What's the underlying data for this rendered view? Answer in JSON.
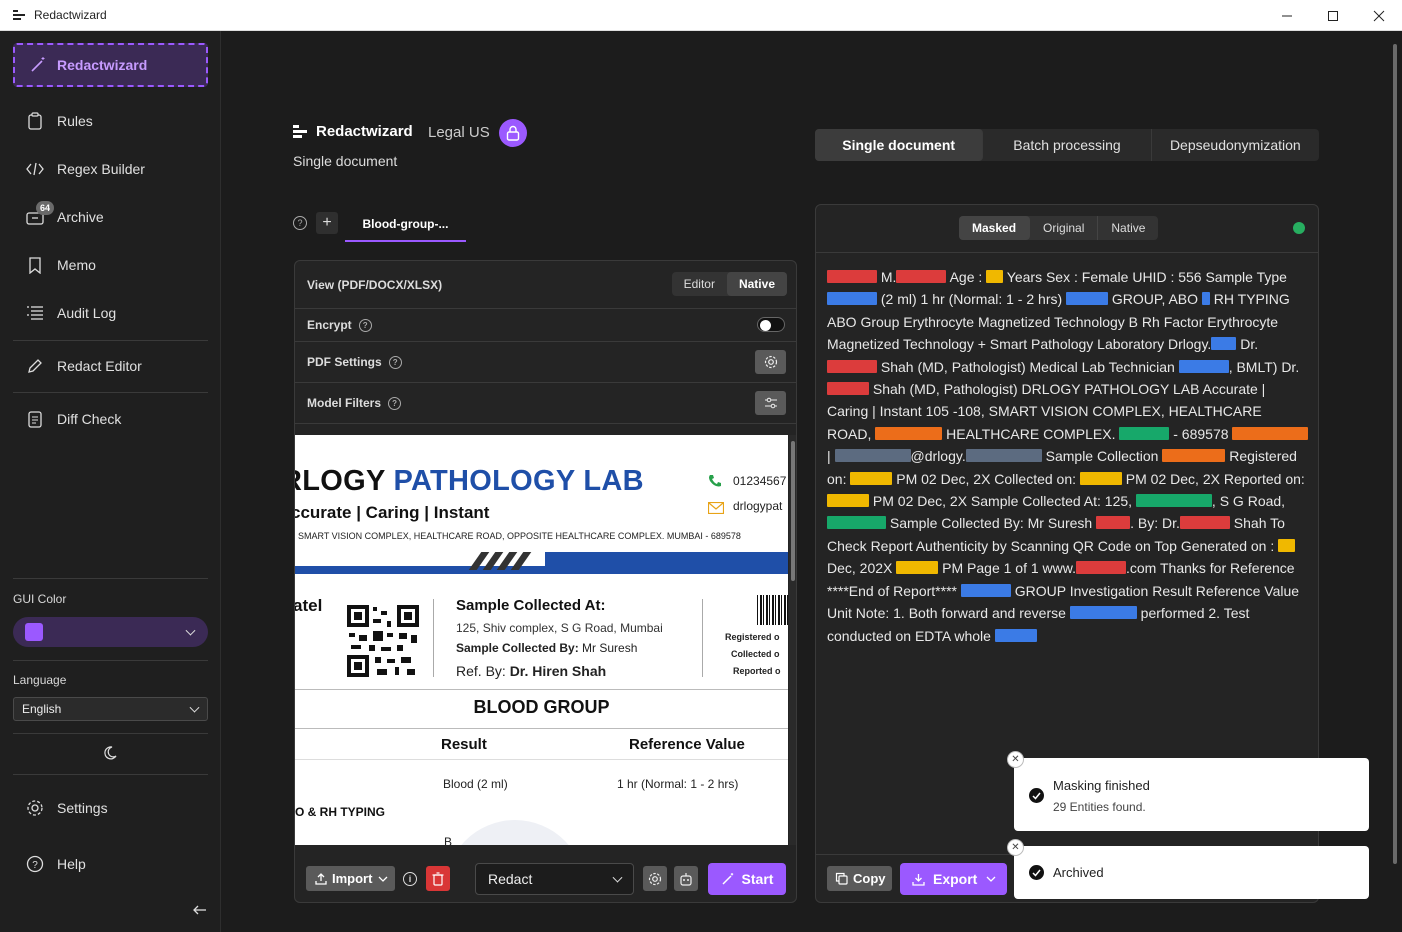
{
  "window": {
    "title": "Redactwizard"
  },
  "sidebar": {
    "active_item": "Redactwizard",
    "items": [
      {
        "label": "Rules",
        "icon": "clipboard-icon"
      },
      {
        "label": "Regex Builder",
        "icon": "code-icon"
      },
      {
        "label": "Archive",
        "icon": "archive-icon",
        "badge": "64"
      },
      {
        "label": "Memo",
        "icon": "bookmark-icon"
      },
      {
        "label": "Audit Log",
        "icon": "list-icon"
      },
      {
        "label": "Redact Editor",
        "icon": "pencil-icon"
      },
      {
        "label": "Diff Check",
        "icon": "document-icon"
      }
    ],
    "gui_color_label": "GUI Color",
    "gui_color": "#9b59ff",
    "language_label": "Language",
    "language_value": "English",
    "settings_label": "Settings",
    "help_label": "Help"
  },
  "header": {
    "title": "Redactwizard",
    "subtitle": "Legal US",
    "mode": "Single document"
  },
  "doc_tab": {
    "label": "Blood-group-..."
  },
  "left_panel": {
    "view_label": "View (PDF/DOCX/XLSX)",
    "view_options": [
      "Editor",
      "Native"
    ],
    "view_selected": "Native",
    "encrypt_label": "Encrypt",
    "pdf_settings_label": "PDF Settings",
    "model_filters_label": "Model Filters",
    "preview": {
      "lab_part1": "RLOGY ",
      "lab_part2": "PATHOLOGY LAB",
      "tagline": "ccurate  |  Caring  |  Instant",
      "address": "SMART VISION COMPLEX, HEALTHCARE ROAD, OPPOSITE HEALTHCARE COMPLEX. MUMBAI - 689578",
      "phone": "01234567",
      "email": "drlogypat",
      "patient_name": "atel",
      "sample_collected_at": "Sample Collected At:",
      "sample_address": "125, Shiv complex, S G Road, Mumbai",
      "sample_by_label": "Sample Collected By:",
      "sample_by_value": "Mr Suresh",
      "ref_by_label": "Ref. By:",
      "ref_by_value": "Dr. Hiren Shah",
      "registered": "Registered o",
      "collected": "Collected o",
      "reported": "Reported o",
      "report_title": "BLOOD GROUP",
      "col_result": "Result",
      "col_reference": "Reference Value",
      "row_result": "Blood (2 ml)",
      "row_reference": "1 hr (Normal: 1 - 2 hrs)",
      "row_label": "O & RH TYPING",
      "row_cut": "B"
    },
    "import_label": "Import",
    "action_value": "Redact",
    "start_label": "Start"
  },
  "mode_tabs": [
    "Single document",
    "Batch processing",
    "Depseudonymization"
  ],
  "mode_tab_selected": "Single document",
  "right_panel": {
    "view_tabs": [
      "Masked",
      "Original",
      "Native"
    ],
    "view_selected": "Masked",
    "status_color": "#27ae60",
    "copy_label": "Copy",
    "export_label": "Export"
  },
  "masked_text": {
    "t01": "M.",
    "t02": " Age : ",
    "t03": " Years Sex : Female UHID : 556  Sample Type ",
    "t04": " (2 ml)   1 hr (Normal: 1 - 2 hrs) ",
    "t05": " GROUP, ABO ",
    "t06": " RH TYPING ABO Group  Erythrocyte Magnetized Technology   B  Rh Factor  Erythrocyte Magnetized Technology   + Smart Pathology Laboratory Drlogy.",
    "t07": "  Dr. ",
    "t08": " Shah  (MD, Pathologist)  Medical Lab Technician ",
    "t09": ", BMLT) Dr. ",
    "t10": " Shah  (MD, Pathologist)  DRLOGY PATHOLOGY LAB  Accurate | Caring | Instant  105 -108, SMART VISION COMPLEX, HEALTHCARE ROAD, ",
    "t11": " HEALTHCARE COMPLEX. ",
    "t12": " - 689578 ",
    "t13": " | ",
    "t14": "@drlogy.",
    "t15": "  Sample Collection ",
    "t16": " Registered on: ",
    "t17": " PM 02 Dec, 2X  Collected on: ",
    "t18": " PM 02 Dec, 2X  Reported on: ",
    "t19": " PM 02 Dec, 2X  Sample Collected At:  125, ",
    "t20": ", S G Road,",
    "t21": "  Sample Collected By:  Mr Suresh ",
    "t22": ". By:   Dr.",
    "t23": " Shah  To Check Report Authenticity by Scanning QR Code on Top   Generated on : ",
    "t24": " Dec, 202X ",
    "t25": " PM    Page 1 of 1  www.",
    "t26": ".com  Thanks for Reference   ****End of Report**** ",
    "t27": " GROUP Investigation   Result   Reference Value   Unit  Note: 1. Both forward and reverse ",
    "t28": " performed 2. Test conducted on EDTA whole "
  },
  "toasts": [
    {
      "title": "Masking finished",
      "detail": "29 Entities found."
    },
    {
      "title": "Archived"
    }
  ]
}
